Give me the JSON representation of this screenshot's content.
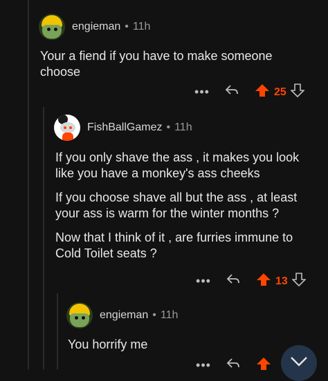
{
  "comments": [
    {
      "author": "engieman",
      "time": "11h",
      "paragraphs": [
        "Your a fiend if you have to make someone choose"
      ],
      "score": "25"
    },
    {
      "author": "FishBallGamez",
      "time": "11h",
      "paragraphs": [
        "If you only shave the ass , it makes you look like you have a monkey's ass cheeks",
        "If you choose shave all but the ass , at least your ass is warm for the winter months ?",
        "Now that I think of it , are furries immune to Cold Toilet seats ?"
      ],
      "score": "13"
    },
    {
      "author": "engieman",
      "time": "11h",
      "paragraphs": [
        "You horrify me"
      ],
      "score": ""
    }
  ],
  "separator": "•",
  "more_label": "•••",
  "colors": {
    "upvote": "#ff4500",
    "background": "#121212",
    "fab": "#24344a"
  },
  "icons": {
    "reply": "reply-icon",
    "upvote": "upvote-icon",
    "downvote": "downvote-icon",
    "collapse": "chevron-down-icon"
  }
}
